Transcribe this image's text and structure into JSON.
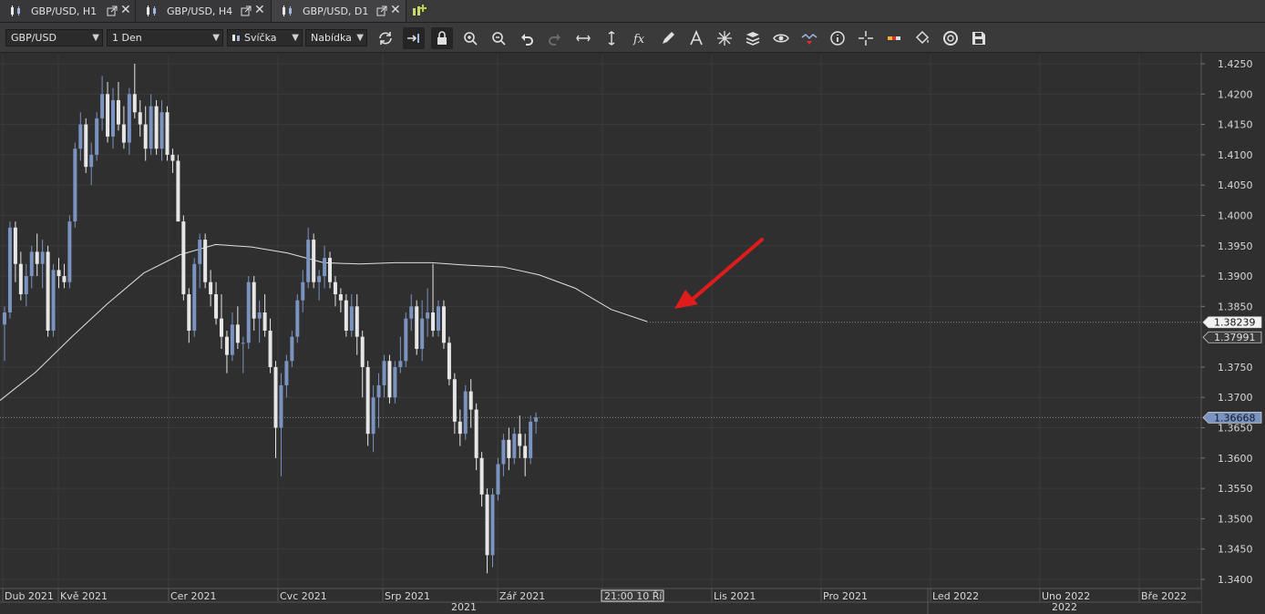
{
  "tabs": [
    {
      "label": "GBP/USD, H1",
      "active": false
    },
    {
      "label": "GBP/USD, H4",
      "active": false
    },
    {
      "label": "GBP/USD, D1",
      "active": true
    }
  ],
  "toolbar": {
    "symbol": "GBP/USD",
    "timeframe": "1 Den",
    "chart_type": "Svíčka",
    "menu": "Nabídka"
  },
  "colors": {
    "background": "#2f2f30",
    "bull_candle": "#7b93bf",
    "bear_candle": "#e6e6e6",
    "moving_average": "#e0e0e0",
    "annotation_arrow": "#e01b1b",
    "last_price_badge": "#7b93bf"
  },
  "chart_data": {
    "type": "candlestick",
    "symbol": "GBP/USD",
    "timeframe": "D1",
    "x_ticks": [
      "Dub 2021",
      "Kvě 2021",
      "Cer 2021",
      "Cvc 2021",
      "Srp 2021",
      "Zář 2021",
      "21:00 10 Říj",
      "Lis 2021",
      "Pro 2021",
      "Led 2022",
      "Uno 2022",
      "Bře 2022"
    ],
    "year_labels": [
      "2021",
      "2022"
    ],
    "ylim": [
      1.3385,
      1.4265
    ],
    "y_ticks": [
      "1.4250",
      "1.4200",
      "1.4150",
      "1.4100",
      "1.4050",
      "1.4000",
      "1.3950",
      "1.3900",
      "1.3850",
      "1.3750",
      "1.3700",
      "1.3650",
      "1.3600",
      "1.3550",
      "1.3500",
      "1.3450",
      "1.3400"
    ],
    "price_labels": {
      "moving_average": "1.38239",
      "reference": "1.37991",
      "last": "1.36668"
    },
    "moving_average_values": [
      1.3695,
      1.3742,
      1.38,
      1.3855,
      1.3905,
      1.3935,
      1.3952,
      1.3948,
      1.3938,
      1.3922,
      1.392,
      1.3922,
      1.3922,
      1.3918,
      1.3915,
      1.3902,
      1.388,
      1.3845,
      1.3825
    ],
    "candles": [
      [
        1.382,
        1.385,
        1.376,
        1.384
      ],
      [
        1.384,
        1.399,
        1.383,
        1.398
      ],
      [
        1.398,
        1.399,
        1.389,
        1.392
      ],
      [
        1.392,
        1.394,
        1.386,
        1.387
      ],
      [
        1.387,
        1.392,
        1.385,
        1.39
      ],
      [
        1.39,
        1.395,
        1.388,
        1.394
      ],
      [
        1.394,
        1.397,
        1.39,
        1.392
      ],
      [
        1.392,
        1.396,
        1.388,
        1.394
      ],
      [
        1.394,
        1.395,
        1.38,
        1.381
      ],
      [
        1.381,
        1.392,
        1.38,
        1.391
      ],
      [
        1.391,
        1.393,
        1.388,
        1.39
      ],
      [
        1.39,
        1.392,
        1.388,
        1.389
      ],
      [
        1.389,
        1.4,
        1.388,
        1.399
      ],
      [
        1.399,
        1.412,
        1.398,
        1.411
      ],
      [
        1.411,
        1.417,
        1.409,
        1.415
      ],
      [
        1.415,
        1.416,
        1.407,
        1.408
      ],
      [
        1.408,
        1.412,
        1.405,
        1.41
      ],
      [
        1.41,
        1.417,
        1.409,
        1.416
      ],
      [
        1.416,
        1.423,
        1.414,
        1.42
      ],
      [
        1.42,
        1.422,
        1.412,
        1.413
      ],
      [
        1.413,
        1.421,
        1.411,
        1.419
      ],
      [
        1.419,
        1.422,
        1.414,
        1.415
      ],
      [
        1.415,
        1.418,
        1.411,
        1.412
      ],
      [
        1.412,
        1.421,
        1.41,
        1.42
      ],
      [
        1.42,
        1.425,
        1.416,
        1.417
      ],
      [
        1.417,
        1.419,
        1.413,
        1.415
      ],
      [
        1.415,
        1.418,
        1.409,
        1.411
      ],
      [
        1.411,
        1.42,
        1.41,
        1.418
      ],
      [
        1.418,
        1.419,
        1.41,
        1.411
      ],
      [
        1.411,
        1.419,
        1.409,
        1.417
      ],
      [
        1.417,
        1.418,
        1.409,
        1.41
      ],
      [
        1.41,
        1.411,
        1.407,
        1.409
      ],
      [
        1.409,
        1.41,
        1.399,
        1.399
      ],
      [
        1.399,
        1.4,
        1.386,
        1.387
      ],
      [
        1.387,
        1.388,
        1.379,
        1.381
      ],
      [
        1.381,
        1.393,
        1.38,
        1.392
      ],
      [
        1.392,
        1.397,
        1.388,
        1.396
      ],
      [
        1.396,
        1.397,
        1.388,
        1.389
      ],
      [
        1.389,
        1.391,
        1.385,
        1.387
      ],
      [
        1.387,
        1.389,
        1.382,
        1.383
      ],
      [
        1.383,
        1.387,
        1.378,
        1.38
      ],
      [
        1.38,
        1.381,
        1.374,
        1.377
      ],
      [
        1.377,
        1.384,
        1.376,
        1.382
      ],
      [
        1.382,
        1.385,
        1.378,
        1.379
      ],
      [
        1.379,
        1.38,
        1.374,
        1.379
      ],
      [
        1.379,
        1.39,
        1.378,
        1.389
      ],
      [
        1.389,
        1.39,
        1.381,
        1.383
      ],
      [
        1.383,
        1.386,
        1.379,
        1.384
      ],
      [
        1.384,
        1.387,
        1.38,
        1.381
      ],
      [
        1.381,
        1.383,
        1.374,
        1.375
      ],
      [
        1.375,
        1.376,
        1.36,
        1.365
      ],
      [
        1.365,
        1.374,
        1.357,
        1.372
      ],
      [
        1.372,
        1.377,
        1.37,
        1.376
      ],
      [
        1.376,
        1.381,
        1.375,
        1.38
      ],
      [
        1.38,
        1.387,
        1.379,
        1.386
      ],
      [
        1.386,
        1.391,
        1.384,
        1.389
      ],
      [
        1.389,
        1.398,
        1.388,
        1.396
      ],
      [
        1.396,
        1.397,
        1.388,
        1.389
      ],
      [
        1.389,
        1.391,
        1.386,
        1.39
      ],
      [
        1.39,
        1.395,
        1.388,
        1.393
      ],
      [
        1.393,
        1.394,
        1.388,
        1.389
      ],
      [
        1.389,
        1.39,
        1.385,
        1.387
      ],
      [
        1.387,
        1.388,
        1.384,
        1.386
      ],
      [
        1.386,
        1.387,
        1.38,
        1.381
      ],
      [
        1.381,
        1.387,
        1.38,
        1.385
      ],
      [
        1.385,
        1.387,
        1.377,
        1.38
      ],
      [
        1.38,
        1.381,
        1.37,
        1.375
      ],
      [
        1.375,
        1.376,
        1.362,
        1.364
      ],
      [
        1.364,
        1.372,
        1.361,
        1.37
      ],
      [
        1.37,
        1.374,
        1.365,
        1.372
      ],
      [
        1.372,
        1.377,
        1.37,
        1.376
      ],
      [
        1.376,
        1.377,
        1.369,
        1.37
      ],
      [
        1.37,
        1.376,
        1.369,
        1.375
      ],
      [
        1.375,
        1.38,
        1.374,
        1.376
      ],
      [
        1.376,
        1.384,
        1.375,
        1.383
      ],
      [
        1.383,
        1.387,
        1.381,
        1.385
      ],
      [
        1.385,
        1.386,
        1.377,
        1.378
      ],
      [
        1.378,
        1.386,
        1.376,
        1.383
      ],
      [
        1.383,
        1.388,
        1.38,
        1.384
      ],
      [
        1.384,
        1.392,
        1.38,
        1.381
      ],
      [
        1.381,
        1.386,
        1.38,
        1.385
      ],
      [
        1.385,
        1.386,
        1.378,
        1.379
      ],
      [
        1.379,
        1.38,
        1.372,
        1.373
      ],
      [
        1.373,
        1.374,
        1.364,
        1.366
      ],
      [
        1.366,
        1.368,
        1.362,
        1.364
      ],
      [
        1.364,
        1.372,
        1.363,
        1.371
      ],
      [
        1.371,
        1.373,
        1.365,
        1.368
      ],
      [
        1.368,
        1.369,
        1.358,
        1.36
      ],
      [
        1.36,
        1.361,
        1.352,
        1.354
      ],
      [
        1.354,
        1.355,
        1.341,
        1.344
      ],
      [
        1.344,
        1.355,
        1.342,
        1.354
      ],
      [
        1.354,
        1.36,
        1.353,
        1.359
      ],
      [
        1.359,
        1.364,
        1.357,
        1.363
      ],
      [
        1.363,
        1.365,
        1.358,
        1.36
      ],
      [
        1.36,
        1.365,
        1.359,
        1.364
      ],
      [
        1.364,
        1.367,
        1.36,
        1.362
      ],
      [
        1.362,
        1.364,
        1.357,
        1.36
      ],
      [
        1.36,
        1.367,
        1.359,
        1.366
      ],
      [
        1.366,
        1.3675,
        1.364,
        1.3667
      ]
    ]
  }
}
